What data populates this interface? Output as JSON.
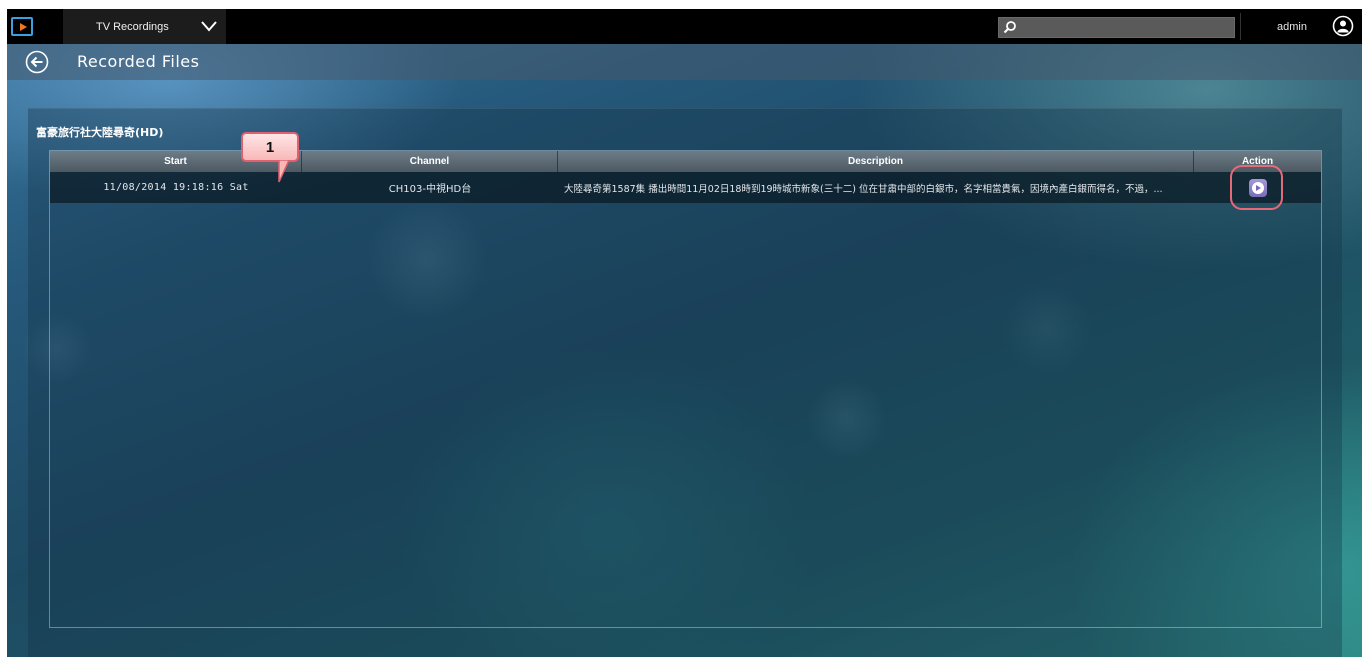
{
  "topbar": {
    "app_menu_label": "TV Recordings",
    "search_placeholder": "",
    "username": "admin"
  },
  "header": {
    "title": "Recorded Files"
  },
  "program": {
    "title": "富豪旅行社大陸尋奇(HD)"
  },
  "table": {
    "columns": [
      "Start",
      "Channel",
      "Description",
      "Action"
    ],
    "rows": [
      {
        "start": "11/08/2014  19:18:16  Sat",
        "channel": "CH103-中視HD台",
        "description": "大陸尋奇第1587集 播出時間11月02日18時到19時城市新象(三十二) 位在甘肅中部的白銀市，名字相當貴氣，因境內產白銀而得名，不過，...",
        "action": "play"
      }
    ]
  },
  "annotations": {
    "callout_number": "1"
  },
  "colors": {
    "topbar_bg": "#000000",
    "accent_logo": "#3aa0e0",
    "logo_play": "#f07820",
    "annotation_red": "#e06070",
    "play_button": "#8a7ac8"
  }
}
